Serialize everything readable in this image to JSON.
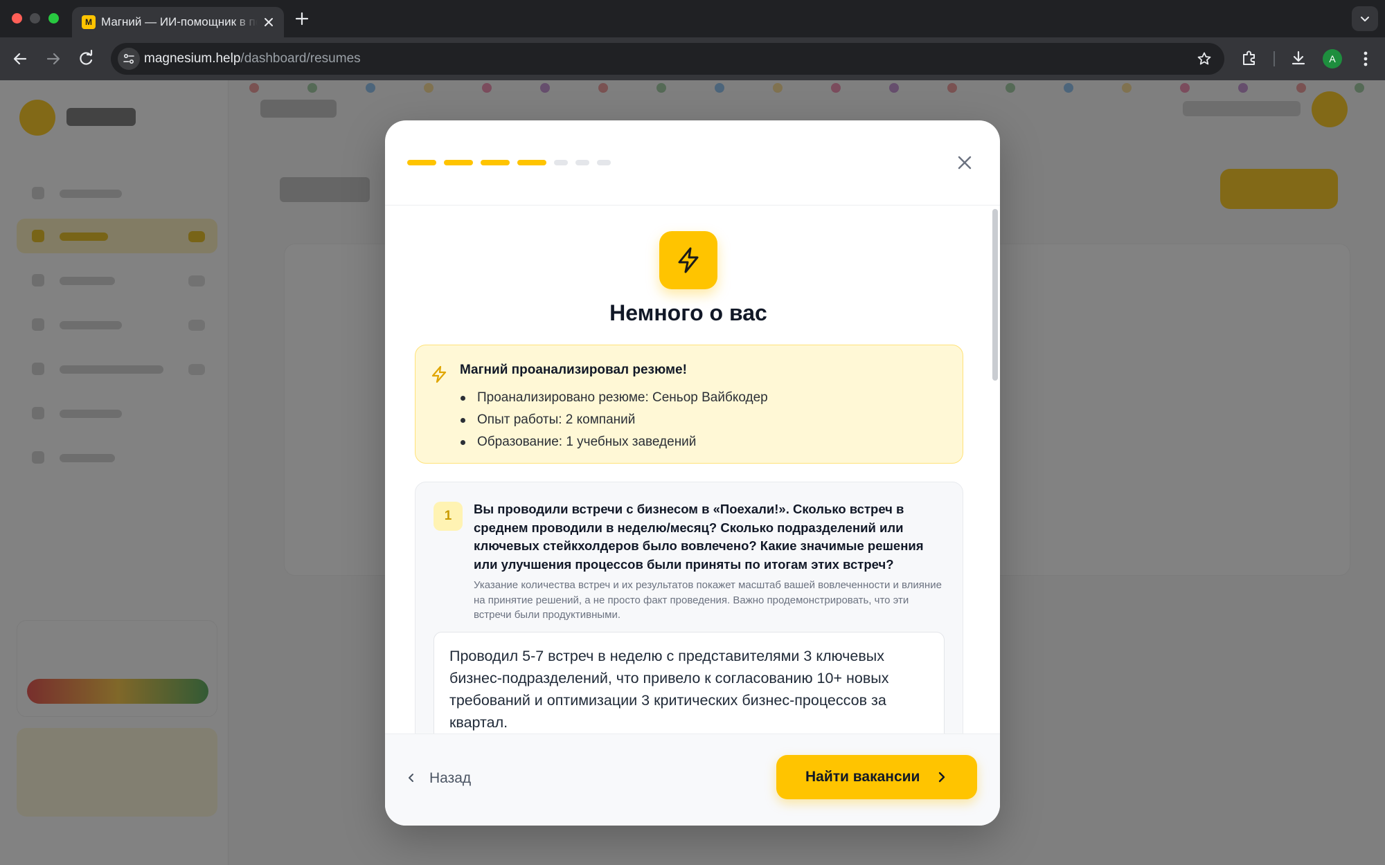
{
  "browser": {
    "tab_favicon_letter": "М",
    "tab_title": "Магний — ИИ-помощник в поиске работы",
    "url_host": "magnesium.help",
    "url_path": "/dashboard/resumes",
    "profile_initial": "A"
  },
  "modal": {
    "steps_total": 7,
    "steps_completed": 4,
    "title": "Немного о вас",
    "analysis": {
      "title": "Магний проанализировал резюме!",
      "items": [
        "Проанализировано резюме: Сеньор Вайбкодер",
        "Опыт работы: 2 компаний",
        "Образование: 1 учебных заведений"
      ]
    },
    "question": {
      "number": "1",
      "text": "Вы проводили встречи с бизнесом в «Поехали!». Сколько встреч в среднем проводили в неделю/месяц? Сколько подразделений или ключевых стейкхолдеров было вовлечено? Какие значимые решения или улучшения процессов были приняты по итогам этих встреч?",
      "hint": "Указание количества встреч и их результатов покажет масштаб вашей вовлеченности и влияние на принятие решений, а не просто факт проведения. Важно продемонстрировать, что эти встречи были продуктивными.",
      "answer": "Проводил 5-7 встреч в неделю с представителями 3 ключевых бизнес-подразделений, что привело к согласованию 10+ новых требований и оптимизации 3 критических бизнес-процессов за квартал."
    },
    "footer": {
      "back_label": "Назад",
      "next_label": "Найти вакансии"
    }
  },
  "colors": {
    "accent": "#ffc400",
    "accent_soft": "#fff8d6",
    "text_dark": "#111827"
  }
}
